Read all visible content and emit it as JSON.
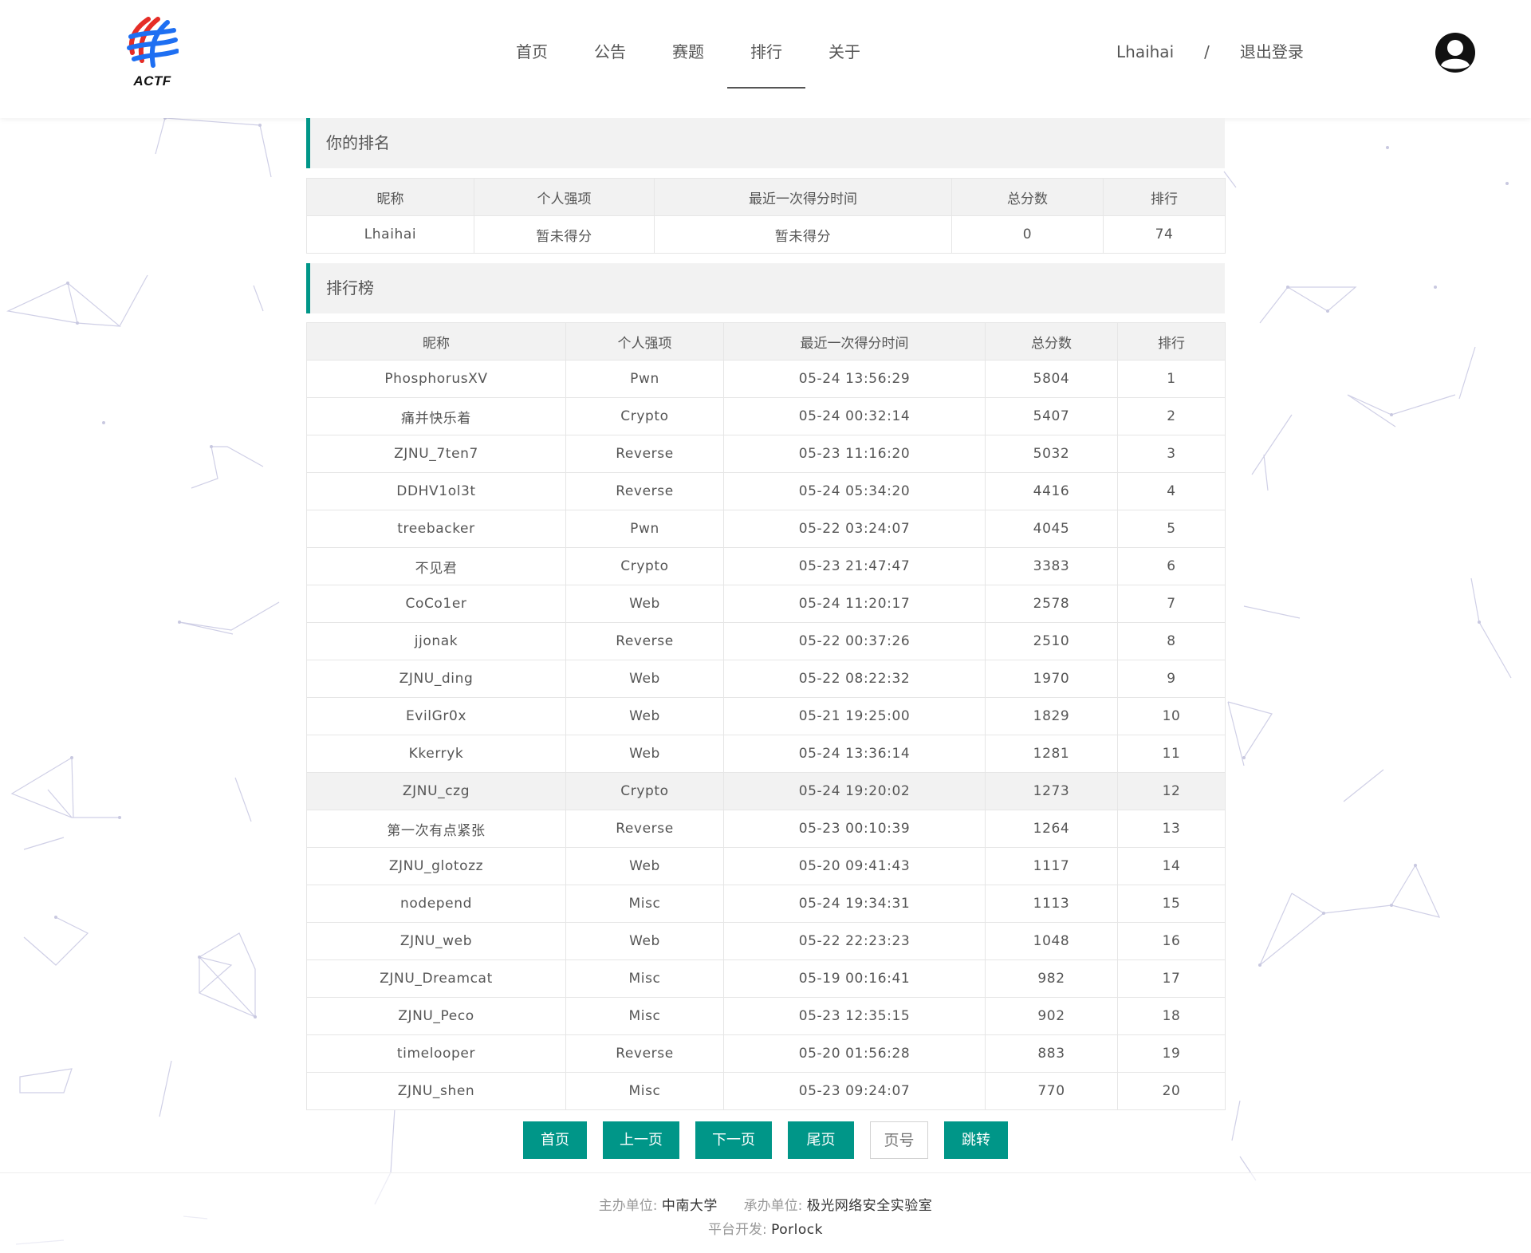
{
  "brand": {
    "logo_text": "ACTF"
  },
  "nav": {
    "items": [
      {
        "label": "首页"
      },
      {
        "label": "公告"
      },
      {
        "label": "赛题"
      },
      {
        "label": "排行"
      },
      {
        "label": "关于"
      }
    ],
    "active": "排行"
  },
  "user": {
    "name": "Lhaihai",
    "separator": "/",
    "logout": "退出登录"
  },
  "my_rank": {
    "title": "你的排名",
    "headers": [
      "昵称",
      "个人强项",
      "最近一次得分时间",
      "总分数",
      "排行"
    ],
    "row": {
      "name": "Lhaihai",
      "strength": "暂未得分",
      "time": "暂未得分",
      "score": "0",
      "rank": "74"
    }
  },
  "leaderboard": {
    "title": "排行榜",
    "headers": [
      "昵称",
      "个人强项",
      "最近一次得分时间",
      "总分数",
      "排行"
    ],
    "rows": [
      {
        "name": "PhosphorusXV",
        "strength": "Pwn",
        "time": "05-24 13:56:29",
        "score": "5804",
        "rank": "1"
      },
      {
        "name": "痛并快乐着",
        "strength": "Crypto",
        "time": "05-24 00:32:14",
        "score": "5407",
        "rank": "2"
      },
      {
        "name": "ZJNU_7ten7",
        "strength": "Reverse",
        "time": "05-23 11:16:20",
        "score": "5032",
        "rank": "3"
      },
      {
        "name": "DDHV1ol3t",
        "strength": "Reverse",
        "time": "05-24 05:34:20",
        "score": "4416",
        "rank": "4"
      },
      {
        "name": "treebacker",
        "strength": "Pwn",
        "time": "05-22 03:24:07",
        "score": "4045",
        "rank": "5"
      },
      {
        "name": "不见君",
        "strength": "Crypto",
        "time": "05-23 21:47:47",
        "score": "3383",
        "rank": "6"
      },
      {
        "name": "CoCo1er",
        "strength": "Web",
        "time": "05-24 11:20:17",
        "score": "2578",
        "rank": "7"
      },
      {
        "name": "jjonak",
        "strength": "Reverse",
        "time": "05-22 00:37:26",
        "score": "2510",
        "rank": "8"
      },
      {
        "name": "ZJNU_ding",
        "strength": "Web",
        "time": "05-22 08:22:32",
        "score": "1970",
        "rank": "9"
      },
      {
        "name": "EvilGr0x",
        "strength": "Web",
        "time": "05-21 19:25:00",
        "score": "1829",
        "rank": "10"
      },
      {
        "name": "Kkerryk",
        "strength": "Web",
        "time": "05-24 13:36:14",
        "score": "1281",
        "rank": "11"
      },
      {
        "name": "ZJNU_czg",
        "strength": "Crypto",
        "time": "05-24 19:20:02",
        "score": "1273",
        "rank": "12"
      },
      {
        "name": "第一次有点紧张",
        "strength": "Reverse",
        "time": "05-23 00:10:39",
        "score": "1264",
        "rank": "13"
      },
      {
        "name": "ZJNU_glotozz",
        "strength": "Web",
        "time": "05-20 09:41:43",
        "score": "1117",
        "rank": "14"
      },
      {
        "name": "nodepend",
        "strength": "Misc",
        "time": "05-24 19:34:31",
        "score": "1113",
        "rank": "15"
      },
      {
        "name": "ZJNU_web",
        "strength": "Web",
        "time": "05-22 22:23:23",
        "score": "1048",
        "rank": "16"
      },
      {
        "name": "ZJNU_Dreamcat",
        "strength": "Misc",
        "time": "05-19 00:16:41",
        "score": "982",
        "rank": "17"
      },
      {
        "name": "ZJNU_Peco",
        "strength": "Misc",
        "time": "05-23 12:35:15",
        "score": "902",
        "rank": "18"
      },
      {
        "name": "timelooper",
        "strength": "Reverse",
        "time": "05-20 01:56:28",
        "score": "883",
        "rank": "19"
      },
      {
        "name": "ZJNU_shen",
        "strength": "Misc",
        "time": "05-23 09:24:07",
        "score": "770",
        "rank": "20"
      }
    ],
    "highlighted_rank": "12"
  },
  "pager": {
    "first": "首页",
    "prev": "上一页",
    "next": "下一页",
    "last": "尾页",
    "page_placeholder": "页号",
    "go": "跳转"
  },
  "footer": {
    "host_label": "主办单位:",
    "host": "中南大学",
    "organizer_label": "承办单位:",
    "organizer": "极光网络安全实验室",
    "dev_label": "平台开发:",
    "dev": "Porlock"
  },
  "colors": {
    "accent": "#009688",
    "header_bg": "#f2f2f2",
    "text": "#555555"
  },
  "icons": [
    "actf-logo",
    "user-avatar-icon"
  ]
}
